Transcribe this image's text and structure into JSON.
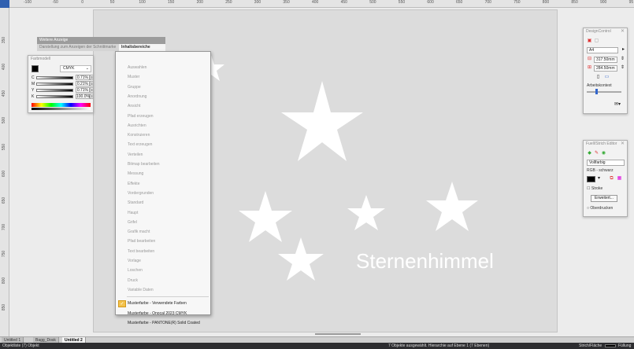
{
  "rulers": {
    "top_labels": [
      "-100",
      "-50",
      "0",
      "50",
      "100",
      "150",
      "200",
      "250",
      "300",
      "350",
      "400",
      "450",
      "500",
      "550",
      "600",
      "650",
      "700",
      "750",
      "800",
      "850",
      "900",
      "95"
    ],
    "left_labels": [
      "350",
      "400",
      "450",
      "500",
      "550",
      "600",
      "650",
      "700",
      "750",
      "800",
      "850"
    ]
  },
  "ribbon": {
    "message": "Weitere Anzeige",
    "row_left": "Darstellung zum Anzeigen der Schnittmarke",
    "row_highlight": "Inhaltsbereiche bearbeiten"
  },
  "color_panel": {
    "title": "Farbmodell",
    "model": "CMYK",
    "rows": [
      {
        "letter": "C",
        "value": "0.71%"
      },
      {
        "letter": "M",
        "value": "0.21%"
      },
      {
        "letter": "Y",
        "value": "0.71%"
      },
      {
        "letter": "K",
        "value": "100.0%"
      }
    ]
  },
  "context_menu": {
    "items": [
      {
        "label": "Auswahlen",
        "enabled": false
      },
      {
        "label": "Muster",
        "enabled": false
      },
      {
        "label": "Gruppe",
        "enabled": false
      },
      {
        "label": "Anordnung",
        "enabled": false
      },
      {
        "label": "Ansicht",
        "enabled": false
      },
      {
        "label": "Pfad erzeugen",
        "enabled": false
      },
      {
        "label": "Ausrichten",
        "enabled": false
      },
      {
        "label": "Konstruieren",
        "enabled": false
      },
      {
        "label": "Text erzeugen",
        "enabled": false
      },
      {
        "label": "Verteilen",
        "enabled": false
      },
      {
        "label": "Bitmap bearbeiten",
        "enabled": false
      },
      {
        "label": "Messung",
        "enabled": false
      },
      {
        "label": "Effekte",
        "enabled": false
      },
      {
        "label": "Vordergrunden",
        "enabled": false
      },
      {
        "label": "Standard",
        "enabled": false
      },
      {
        "label": "Haupt",
        "enabled": false
      },
      {
        "label": "Grifel",
        "enabled": false
      },
      {
        "label": "Grafik macht",
        "enabled": false
      },
      {
        "label": "Pfad bearbeiten",
        "enabled": false
      },
      {
        "label": "Text bearbeiten",
        "enabled": false
      },
      {
        "label": "Vorlage",
        "enabled": false
      },
      {
        "label": "Loschen",
        "enabled": false
      },
      {
        "label": "Druck",
        "enabled": false
      },
      {
        "label": "Variable Daten",
        "enabled": false
      }
    ],
    "palette_items": [
      {
        "label": "Musterfarbe - Verwendete Farben",
        "checked": true
      },
      {
        "label": "Musterfarbe - Onocal 2023 CMYK",
        "checked": false
      },
      {
        "label": "Musterfarbe - PANTONE(R) Solid Coated",
        "checked": false
      }
    ],
    "checkmark": "✓"
  },
  "canvas": {
    "title": "Sternenhimmel",
    "text_color": "#ffffff",
    "background": "#dcdcdc"
  },
  "design_panel": {
    "title": "DesignControl",
    "close": "✕",
    "select_value": "A4",
    "width_value": "317.50mm",
    "height_value": "284.50mm",
    "label": "Arbeitskontext"
  },
  "fill_panel": {
    "title": "Fuell/Strich Editor",
    "close": "✕",
    "select_value": "Vollfarbig",
    "color_label": "RGB - schwarz",
    "checkbox_label": "Stroke",
    "button_label": "Erweitert...",
    "radio_label": "Oberdrucken"
  },
  "tabs": [
    {
      "label": "Untitled 1",
      "active": false
    },
    {
      "label": "Bagg_Dosk",
      "active": false
    },
    {
      "label": "Untitled 2",
      "active": true
    }
  ],
  "status": {
    "left": "Objektliste (7) Objekt",
    "center": "7 Objekte ausgewählt. Hierarchie auf Ebene 1 (7 Ebenen)",
    "right_label": "Strich/Fläche",
    "right_extra": "Füllung"
  }
}
